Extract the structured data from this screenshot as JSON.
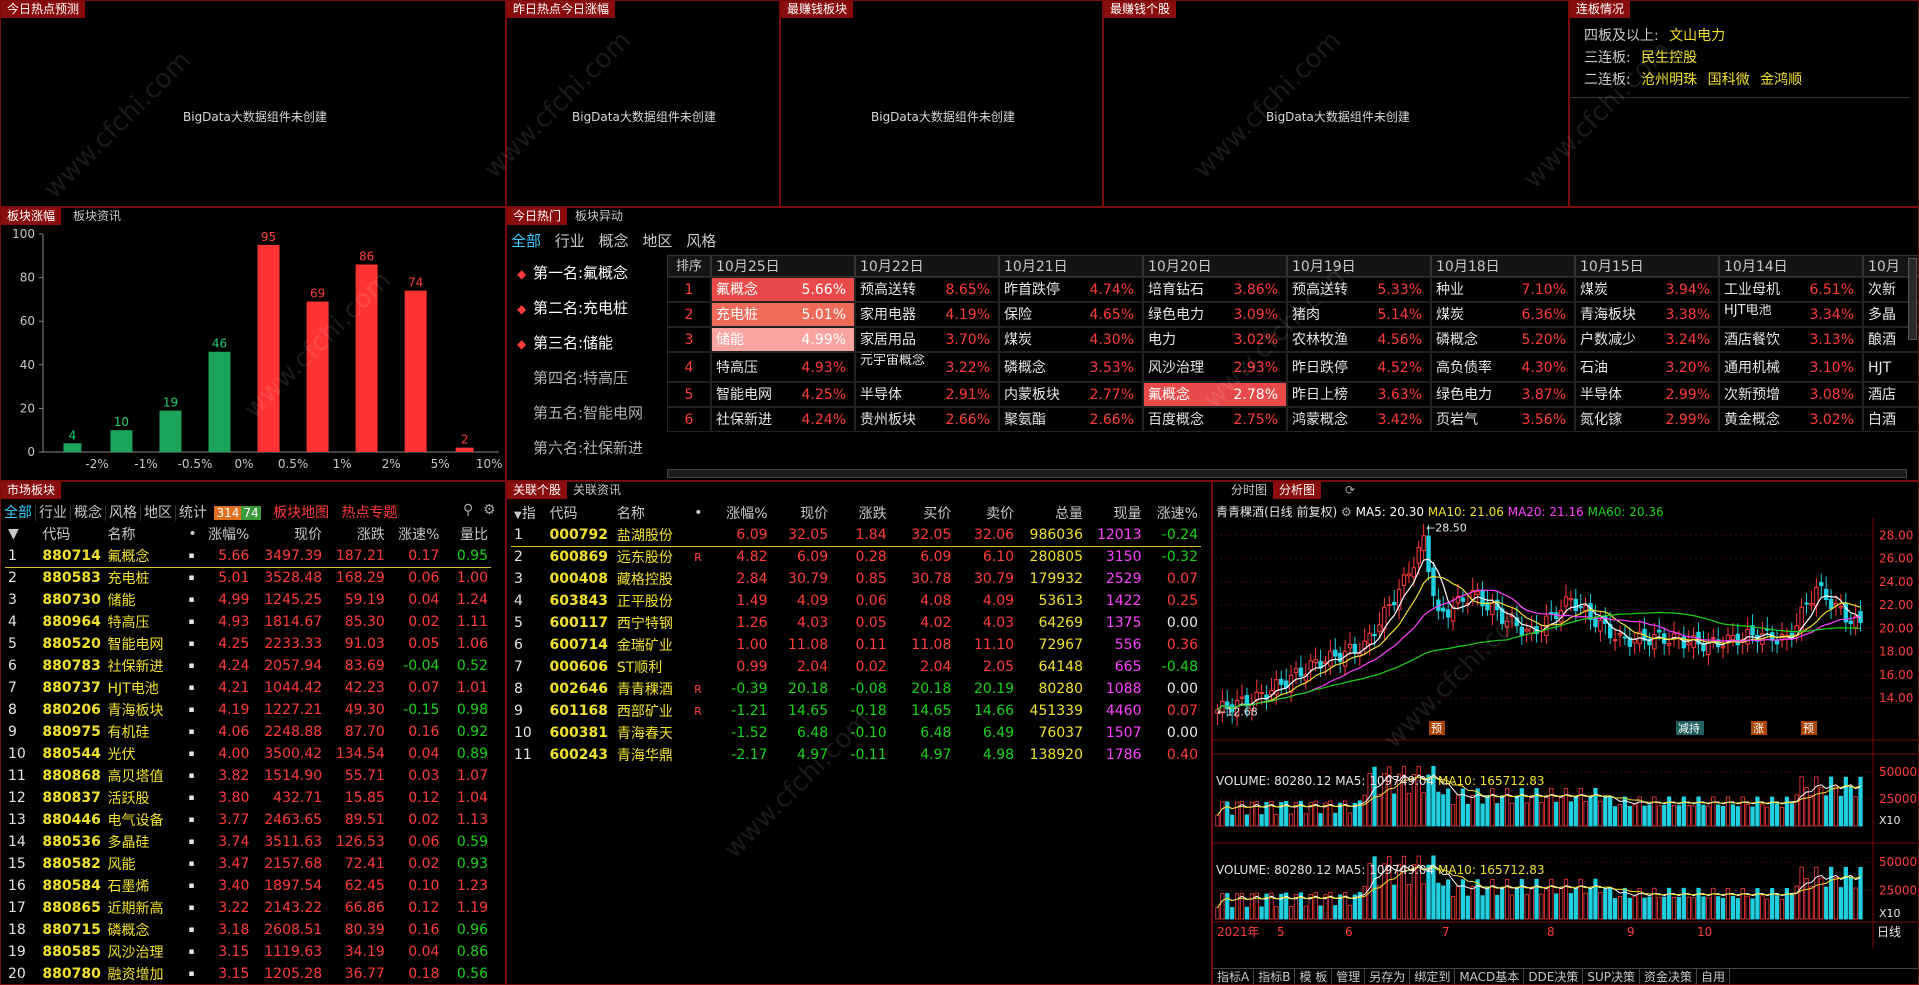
{
  "top_panels": [
    {
      "title": "今日热点预测",
      "placeholder": "BigData大数据组件未创建"
    },
    {
      "title": "昨日热点今日涨幅",
      "placeholder": "BigData大数据组件未创建"
    },
    {
      "title": "最赚钱板块",
      "placeholder": "BigData大数据组件未创建"
    },
    {
      "title": "最赚钱个股",
      "placeholder": "BigData大数据组件未创建"
    }
  ],
  "lianban": {
    "title": "连板情况",
    "rows": [
      {
        "label": "四板及以上:",
        "stocks": [
          "文山电力"
        ]
      },
      {
        "label": "三连板:",
        "stocks": [
          "民生控股"
        ]
      },
      {
        "label": "二连板:",
        "stocks": [
          "沧州明珠",
          "国科微",
          "金鸿顺"
        ]
      }
    ]
  },
  "sector_chart": {
    "tabs": [
      "板块涨幅",
      "板块资讯"
    ],
    "chart_data": {
      "type": "bar",
      "categories": [
        "-2%",
        "-1%",
        "-0.5%",
        "0%",
        "0.5%",
        "1%",
        "2%",
        "5%",
        "10%"
      ],
      "values": [
        4,
        10,
        19,
        46,
        95,
        69,
        86,
        74,
        2
      ],
      "colors": [
        "#1aa55a",
        "#1aa55a",
        "#1aa55a",
        "#1aa55a",
        "#ff3333",
        "#ff3333",
        "#ff3333",
        "#ff3333",
        "#ff3333"
      ],
      "y_ticks": [
        "100",
        "80",
        "60",
        "40",
        "20",
        "0"
      ],
      "ylim": [
        0,
        100
      ]
    }
  },
  "hot": {
    "tabs": [
      "今日热门",
      "板块异动"
    ],
    "filters": [
      "全部",
      "行业",
      "概念",
      "地区",
      "风格"
    ],
    "ranks": [
      {
        "label": "第一名:氟概念",
        "marker": "◆"
      },
      {
        "label": "第二名:充电桩",
        "marker": "◆"
      },
      {
        "label": "第三名:储能",
        "marker": "◆"
      },
      {
        "label": "第四名:特高压",
        "marker": ""
      },
      {
        "label": "第五名:智能电网",
        "marker": ""
      },
      {
        "label": "第六名:社保新进",
        "marker": ""
      }
    ],
    "rank_header": "排序",
    "rank_nums": [
      "1",
      "2",
      "3",
      "4",
      "5",
      "6"
    ],
    "dates": [
      "10月25日",
      "10月22日",
      "10月21日",
      "10月20日",
      "10月19日",
      "10月18日",
      "10月15日",
      "10月14日",
      "10月"
    ],
    "grid": [
      [
        [
          "氟概念",
          "5.66%"
        ],
        [
          "预高送转",
          "8.65%"
        ],
        [
          "昨首跌停",
          "4.74%"
        ],
        [
          "培育钻石",
          "3.86%"
        ],
        [
          "预高送转",
          "5.33%"
        ],
        [
          "种业",
          "7.10%"
        ],
        [
          "煤炭",
          "3.94%"
        ],
        [
          "工业母机",
          "6.51%"
        ],
        [
          "次新",
          ""
        ]
      ],
      [
        [
          "充电桩",
          "5.01%"
        ],
        [
          "家用电器",
          "4.19%"
        ],
        [
          "保险",
          "4.65%"
        ],
        [
          "绿色电力",
          "3.09%"
        ],
        [
          "猪肉",
          "5.14%"
        ],
        [
          "煤炭",
          "6.36%"
        ],
        [
          "青海板块",
          "3.38%"
        ],
        [
          "HJT电池",
          "3.34%"
        ],
        [
          "多晶",
          ""
        ]
      ],
      [
        [
          "储能",
          "4.99%"
        ],
        [
          "家居用品",
          "3.70%"
        ],
        [
          "煤炭",
          "4.30%"
        ],
        [
          "电力",
          "3.02%"
        ],
        [
          "农林牧渔",
          "4.56%"
        ],
        [
          "磷概念",
          "5.20%"
        ],
        [
          "户数减少",
          "3.24%"
        ],
        [
          "酒店餐饮",
          "3.13%"
        ],
        [
          "酿酒",
          ""
        ]
      ],
      [
        [
          "特高压",
          "4.93%"
        ],
        [
          "元宇宙概念",
          "3.22%"
        ],
        [
          "磷概念",
          "3.53%"
        ],
        [
          "风沙治理",
          "2.93%"
        ],
        [
          "昨日跌停",
          "4.52%"
        ],
        [
          "高负债率",
          "4.30%"
        ],
        [
          "石油",
          "3.20%"
        ],
        [
          "通用机械",
          "3.10%"
        ],
        [
          "HJT",
          ""
        ]
      ],
      [
        [
          "智能电网",
          "4.25%"
        ],
        [
          "半导体",
          "2.91%"
        ],
        [
          "内蒙板块",
          "2.77%"
        ],
        [
          "氟概念",
          "2.78%"
        ],
        [
          "昨日上榜",
          "3.63%"
        ],
        [
          "绿色电力",
          "3.87%"
        ],
        [
          "半导体",
          "2.99%"
        ],
        [
          "次新预增",
          "3.08%"
        ],
        [
          "酒店",
          ""
        ]
      ],
      [
        [
          "社保新进",
          "4.24%"
        ],
        [
          "贵州板块",
          "2.66%"
        ],
        [
          "聚氨酯",
          "2.66%"
        ],
        [
          "百度概念",
          "2.75%"
        ],
        [
          "鸿蒙概念",
          "3.42%"
        ],
        [
          "页岩气",
          "3.56%"
        ],
        [
          "氮化镓",
          "2.99%"
        ],
        [
          "黄金概念",
          "3.02%"
        ],
        [
          "白酒",
          ""
        ]
      ]
    ]
  },
  "market": {
    "title": "市场板块",
    "tabs": [
      "全部",
      "行业",
      "概念",
      "风格",
      "地区",
      "统计"
    ],
    "counts": [
      "314",
      "74"
    ],
    "links": [
      "板块地图",
      "热点专题"
    ],
    "headers": [
      "代码",
      "名称",
      "•",
      "涨幅%",
      "现价",
      "涨跌",
      "涨速%",
      "量比"
    ],
    "rows": [
      [
        "1",
        "880714",
        "氟概念",
        "5.66",
        "3497.39",
        "187.21",
        "0.17",
        "0.95"
      ],
      [
        "2",
        "880583",
        "充电桩",
        "5.01",
        "3528.48",
        "168.29",
        "0.06",
        "1.00"
      ],
      [
        "3",
        "880730",
        "储能",
        "4.99",
        "1245.25",
        "59.19",
        "0.04",
        "1.24"
      ],
      [
        "4",
        "880964",
        "特高压",
        "4.93",
        "1814.67",
        "85.30",
        "0.02",
        "1.11"
      ],
      [
        "5",
        "880520",
        "智能电网",
        "4.25",
        "2233.33",
        "91.03",
        "0.05",
        "1.06"
      ],
      [
        "6",
        "880783",
        "社保新进",
        "4.24",
        "2057.94",
        "83.69",
        "-0.04",
        "0.52"
      ],
      [
        "7",
        "880737",
        "HJT电池",
        "4.21",
        "1044.42",
        "42.23",
        "0.07",
        "1.01"
      ],
      [
        "8",
        "880206",
        "青海板块",
        "4.19",
        "1227.21",
        "49.30",
        "-0.15",
        "0.98"
      ],
      [
        "9",
        "880975",
        "有机硅",
        "4.06",
        "2248.88",
        "87.70",
        "0.16",
        "0.92"
      ],
      [
        "10",
        "880544",
        "光伏",
        "4.00",
        "3500.42",
        "134.54",
        "0.04",
        "0.89"
      ],
      [
        "11",
        "880868",
        "高贝塔值",
        "3.82",
        "1514.90",
        "55.71",
        "0.03",
        "1.07"
      ],
      [
        "12",
        "880837",
        "活跃股",
        "3.80",
        "432.71",
        "15.85",
        "0.12",
        "1.04"
      ],
      [
        "13",
        "880446",
        "电气设备",
        "3.77",
        "2463.65",
        "89.51",
        "0.02",
        "1.13"
      ],
      [
        "14",
        "880536",
        "多晶硅",
        "3.74",
        "3511.63",
        "126.53",
        "0.06",
        "0.59"
      ],
      [
        "15",
        "880582",
        "风能",
        "3.47",
        "2157.68",
        "72.41",
        "0.02",
        "0.93"
      ],
      [
        "16",
        "880584",
        "石墨烯",
        "3.40",
        "1897.54",
        "62.45",
        "0.10",
        "1.23"
      ],
      [
        "17",
        "880865",
        "近期新高",
        "3.22",
        "2143.22",
        "66.86",
        "0.12",
        "1.19"
      ],
      [
        "18",
        "880715",
        "磷概念",
        "3.18",
        "2608.51",
        "80.39",
        "0.16",
        "0.96"
      ],
      [
        "19",
        "880585",
        "风沙治理",
        "3.15",
        "1119.63",
        "34.19",
        "0.04",
        "0.86"
      ],
      [
        "20",
        "880780",
        "融资增加",
        "3.15",
        "1205.28",
        "36.77",
        "0.18",
        "0.56"
      ]
    ]
  },
  "related": {
    "tabs": [
      "关联个股",
      "关联资讯"
    ],
    "headers": [
      "指",
      "代码",
      "名称",
      "•",
      "涨幅%",
      "现价",
      "涨跌",
      "买价",
      "卖价",
      "总量",
      "现量",
      "涨速%"
    ],
    "rows": [
      [
        "1",
        "000792",
        "盐湖股份",
        "",
        "6.09",
        "32.05",
        "1.84",
        "32.05",
        "32.06",
        "986036",
        "12013",
        "-0.24"
      ],
      [
        "2",
        "600869",
        "远东股份",
        "R",
        "4.82",
        "6.09",
        "0.28",
        "6.09",
        "6.10",
        "280805",
        "3150",
        "-0.32"
      ],
      [
        "3",
        "000408",
        "藏格控股",
        "",
        "2.84",
        "30.79",
        "0.85",
        "30.78",
        "30.79",
        "179932",
        "2529",
        "0.07"
      ],
      [
        "4",
        "603843",
        "正平股份",
        "",
        "1.49",
        "4.09",
        "0.06",
        "4.08",
        "4.09",
        "53613",
        "1422",
        "0.25"
      ],
      [
        "5",
        "600117",
        "西宁特钢",
        "",
        "1.26",
        "4.03",
        "0.05",
        "4.02",
        "4.03",
        "64269",
        "1375",
        "0.00"
      ],
      [
        "6",
        "600714",
        "金瑞矿业",
        "",
        "1.00",
        "11.08",
        "0.11",
        "11.08",
        "11.10",
        "72967",
        "556",
        "0.36"
      ],
      [
        "7",
        "000606",
        "ST顺利",
        "",
        "0.99",
        "2.04",
        "0.02",
        "2.04",
        "2.05",
        "64148",
        "665",
        "-0.48"
      ],
      [
        "8",
        "002646",
        "青青稞酒",
        "R",
        "-0.39",
        "20.18",
        "-0.08",
        "20.18",
        "20.19",
        "80280",
        "1088",
        "0.00"
      ],
      [
        "9",
        "601168",
        "西部矿业",
        "R",
        "-1.21",
        "14.65",
        "-0.18",
        "14.65",
        "14.66",
        "451339",
        "4460",
        "0.07"
      ],
      [
        "10",
        "600381",
        "青海春天",
        "",
        "-1.52",
        "6.48",
        "-0.10",
        "6.48",
        "6.49",
        "76037",
        "1507",
        "0.00"
      ],
      [
        "11",
        "600243",
        "青海华鼎",
        "",
        "-2.17",
        "4.97",
        "-0.11",
        "4.97",
        "4.98",
        "138920",
        "1786",
        "0.40"
      ]
    ]
  },
  "kline": {
    "tabs": [
      "分时图",
      "分析图"
    ],
    "title": "青青稞酒(日线 前复权)",
    "ma": [
      "MA5: 20.30",
      "MA10: 21.06",
      "MA20: 21.16",
      "MA60: 20.36"
    ],
    "ma_colors": [
      "#ffffff",
      "#f0e030",
      "#ff40ff",
      "#19d219"
    ],
    "y_ticks": [
      "28.00",
      "26.00",
      "24.00",
      "22.00",
      "20.00",
      "18.00",
      "16.00",
      "14.00"
    ],
    "high_label": "28.50",
    "low_label": "12.68",
    "events": [
      "预",
      "减持",
      "涨",
      "预"
    ],
    "vol1": {
      "label": "VOLUME: 80280.12",
      "ma5": "MA5: 109749.04",
      "ma10": "MA10: 165712.83",
      "ticks": [
        "50000",
        "25000"
      ],
      "unit": "X10"
    },
    "vol2": {
      "label": "VOLUME: 80280.12",
      "ma5": "MA5: 109749.04",
      "ma10": "MA10: 165712.83",
      "ticks": [
        "50000",
        "25000"
      ],
      "unit": "X10"
    },
    "x_labels": [
      "2021年",
      "5",
      "6",
      "7",
      "8",
      "9",
      "10"
    ],
    "period": "日线",
    "bottom_tabs": [
      "指标A",
      "指标B",
      "模 板",
      "管理",
      "另存为",
      "绑定到",
      "MACD基本",
      "DDE决策",
      "SUP决策",
      "资金决策",
      "自用"
    ]
  }
}
